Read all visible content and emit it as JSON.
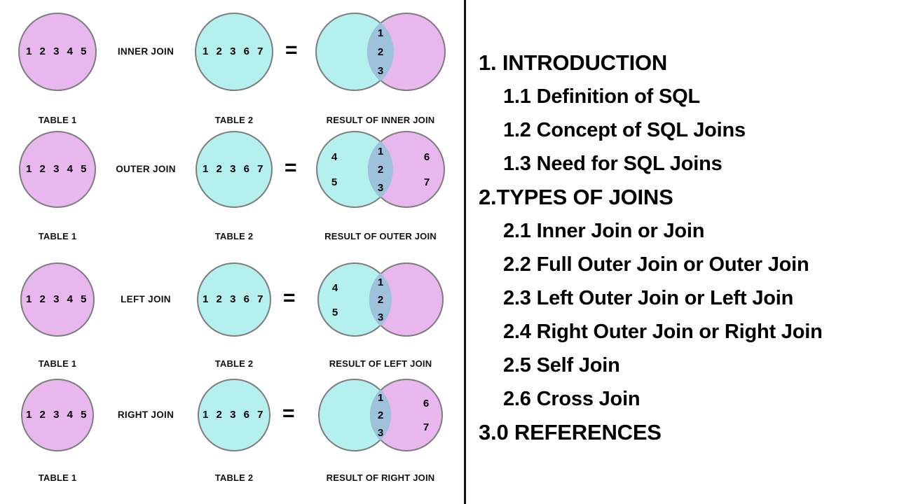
{
  "layout": {
    "background": "#ffffff",
    "divider_color": "#111111",
    "colors": {
      "table1_fill": "#e8b7ee",
      "table2_fill": "#b4f0ee",
      "intersection_fill": "#9ec1dc",
      "circle_stroke": "#7d7d7d",
      "text": "#111111"
    }
  },
  "diagram": {
    "equals_symbol": "=",
    "rows": [
      {
        "operation_label": "INNER JOIN",
        "left": {
          "caption": "TABLE 1",
          "values": "1  2  3  4  5",
          "fill": "purple"
        },
        "right": {
          "caption": "TABLE 2",
          "values": "1  2  3  6  7",
          "fill": "cyan"
        },
        "result": {
          "caption": "RESULT OF INNER JOIN",
          "left_only": [],
          "intersection": [
            "1",
            "2",
            "3"
          ],
          "right_only": []
        }
      },
      {
        "operation_label": "OUTER JOIN",
        "left": {
          "caption": "TABLE 1",
          "values": "1  2  3  4  5",
          "fill": "purple"
        },
        "right": {
          "caption": "TABLE 2",
          "values": "1  2  3  6  7",
          "fill": "cyan"
        },
        "result": {
          "caption": "RESULT OF OUTER JOIN",
          "left_only": [
            "4",
            "5"
          ],
          "intersection": [
            "1",
            "2",
            "3"
          ],
          "right_only": [
            "6",
            "7"
          ]
        }
      },
      {
        "operation_label": "LEFT JOIN",
        "left": {
          "caption": "TABLE 1",
          "values": "1  2  3  4  5",
          "fill": "purple"
        },
        "right": {
          "caption": "TABLE 2",
          "values": "1  2  3  6  7",
          "fill": "cyan"
        },
        "result": {
          "caption": "RESULT OF LEFT JOIN",
          "left_only": [
            "4",
            "5"
          ],
          "intersection": [
            "1",
            "2",
            "3"
          ],
          "right_only": []
        }
      },
      {
        "operation_label": "RIGHT JOIN",
        "left": {
          "caption": "TABLE 1",
          "values": "1  2  3  4  5",
          "fill": "purple"
        },
        "right": {
          "caption": "TABLE 2",
          "values": "1  2  3  6  7",
          "fill": "cyan"
        },
        "result": {
          "caption": "RESULT OF RIGHT JOIN",
          "left_only": [],
          "intersection": [
            "1",
            "2",
            "3"
          ],
          "right_only": [
            "6",
            "7"
          ]
        }
      }
    ]
  },
  "outline": {
    "items": [
      {
        "text": "1. INTRODUCTION",
        "level": 1
      },
      {
        "text": "1.1 Definition of SQL",
        "level": 2
      },
      {
        "text": "1.2 Concept of SQL Joins",
        "level": 2
      },
      {
        "text": "1.3 Need for SQL Joins",
        "level": 2
      },
      {
        "text": "2.TYPES OF JOINS",
        "level": 1
      },
      {
        "text": "2.1 Inner Join or Join",
        "level": 2
      },
      {
        "text": "2.2 Full Outer Join or Outer Join",
        "level": 2
      },
      {
        "text": "2.3 Left Outer Join or Left Join",
        "level": 2
      },
      {
        "text": "2.4 Right Outer Join or Right Join",
        "level": 2
      },
      {
        "text": "2.5 Self Join",
        "level": 2
      },
      {
        "text": "2.6 Cross Join",
        "level": 2
      },
      {
        "text": "3.0 REFERENCES",
        "level": 1
      }
    ]
  }
}
